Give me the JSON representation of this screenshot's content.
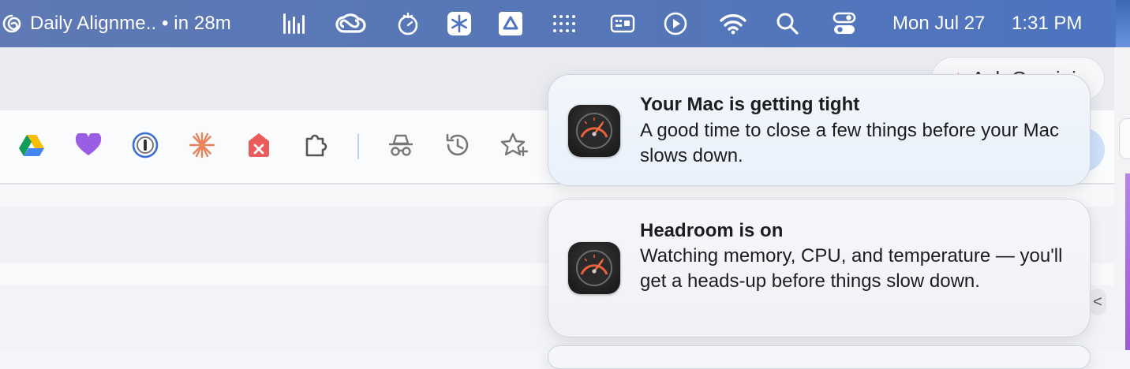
{
  "menubar": {
    "event_text": "Daily Alignme.. • in 28m",
    "date": "Mon Jul 27",
    "time": "1:31 PM",
    "status_icons": [
      "audio-levels-icon",
      "creative-cloud-icon",
      "tomato-timer-icon",
      "snowflake-app-icon",
      "drive-triangle-icon",
      "grid-dots-icon",
      "keyboard-icon",
      "play-circle-icon",
      "wifi-icon",
      "search-icon",
      "control-center-icon"
    ]
  },
  "browser": {
    "ask_button_label": "Ask Gemini",
    "toolbar_icons": [
      "google-drive-icon",
      "heart-icon",
      "password-manager-icon",
      "sparkle-icon",
      "tag-close-icon",
      "extensions-puzzle-icon",
      "incognito-icon",
      "history-icon",
      "star-plus-icon"
    ],
    "side_chevron": "<"
  },
  "notifications": [
    {
      "app_icon": "speedometer-gauge-icon",
      "title": "Your Mac is getting tight",
      "body": "A good time to close a few things before your Mac slows down."
    },
    {
      "app_icon": "speedometer-gauge-icon",
      "title": "Headroom is on",
      "body": "Watching memory, CPU, and temperature — you'll get a heads-up before things slow down."
    }
  ],
  "colors": {
    "menubar": "#5576b8",
    "gauge_accent": "#e8603c",
    "notification_bg": "#f3f6fb"
  }
}
